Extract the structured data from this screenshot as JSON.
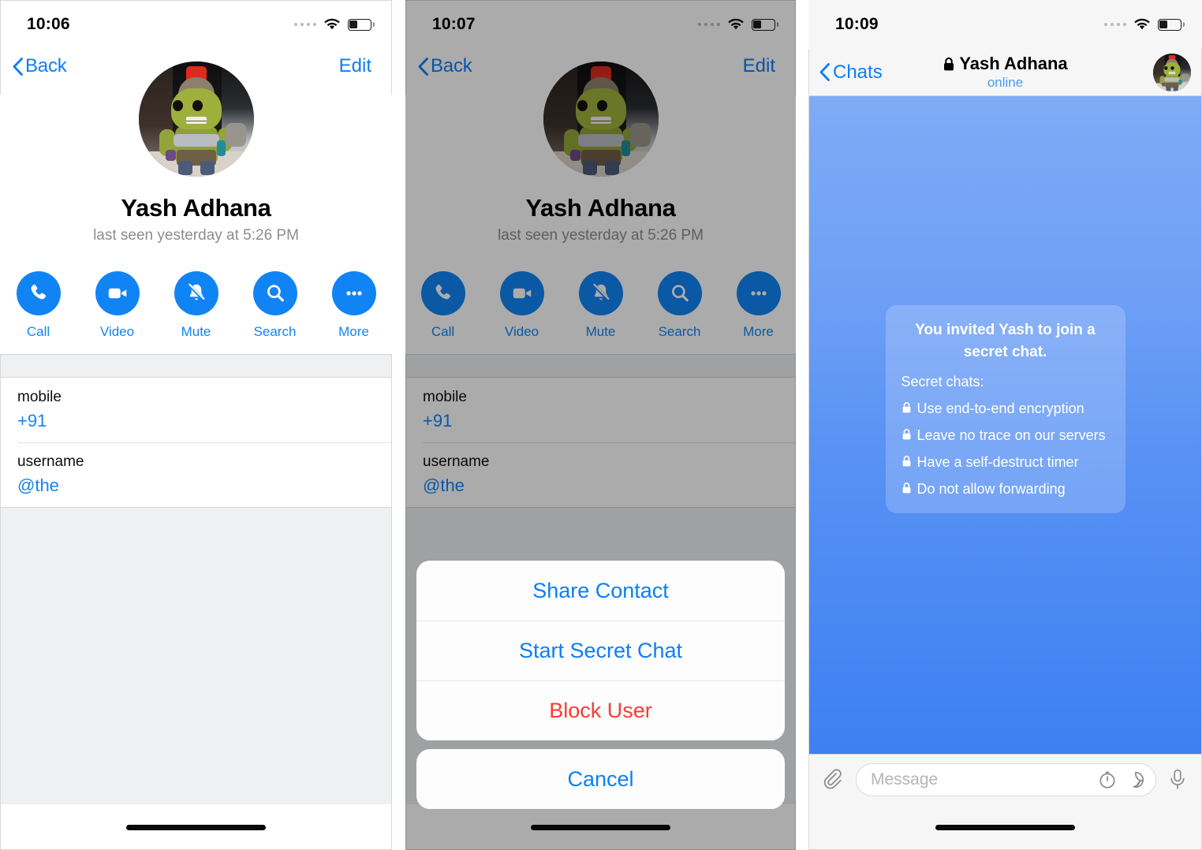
{
  "app": "Telegram iOS",
  "panels": [
    {
      "id": "contact-profile",
      "statusbar": {
        "time": "10:06",
        "signal_icon": "signal-dots-icon",
        "wifi_icon": "wifi-icon",
        "battery_icon": "battery-icon"
      },
      "nav": {
        "back_label": "Back",
        "edit_label": "Edit",
        "back_icon": "chevron-left-icon"
      },
      "profile": {
        "avatar_alt": "hulk-funko-avatar",
        "name": "Yash Adhana",
        "status": "last seen yesterday at 5:26 PM"
      },
      "actions": [
        {
          "label": "Call",
          "icon": "phone-icon"
        },
        {
          "label": "Video",
          "icon": "video-camera-icon"
        },
        {
          "label": "Mute",
          "icon": "bell-slash-icon"
        },
        {
          "label": "Search",
          "icon": "search-icon"
        },
        {
          "label": "More",
          "icon": "ellipsis-icon"
        }
      ],
      "info_rows": [
        {
          "label": "mobile",
          "value": "+91"
        },
        {
          "label": "username",
          "value": "@the"
        }
      ]
    },
    {
      "id": "contact-profile-actionsheet",
      "statusbar": {
        "time": "10:07"
      },
      "nav": {
        "back_label": "Back",
        "edit_label": "Edit"
      },
      "profile": {
        "name": "Yash Adhana",
        "status": "last seen yesterday at 5:26 PM"
      },
      "actions": [
        {
          "label": "Call",
          "icon": "phone-icon"
        },
        {
          "label": "Video",
          "icon": "video-camera-icon"
        },
        {
          "label": "Mute",
          "icon": "bell-slash-icon"
        },
        {
          "label": "Search",
          "icon": "search-icon"
        },
        {
          "label": "More",
          "icon": "ellipsis-icon"
        }
      ],
      "info_rows": [
        {
          "label": "mobile",
          "value": "+91"
        },
        {
          "label": "username",
          "value": "@the"
        }
      ],
      "action_sheet": {
        "items": [
          {
            "label": "Share Contact",
            "style": "default"
          },
          {
            "label": "Start Secret Chat",
            "style": "default"
          },
          {
            "label": "Block User",
            "style": "destructive"
          }
        ],
        "cancel_label": "Cancel"
      }
    },
    {
      "id": "secret-chat",
      "statusbar": {
        "time": "10:09"
      },
      "nav": {
        "back_label": "Chats",
        "title": "Yash Adhana",
        "title_lock_icon": "lock-icon",
        "subtitle": "online",
        "avatar_alt": "hulk-funko-avatar"
      },
      "message": {
        "headline": "You invited Yash to join a secret chat.",
        "intro": "Secret chats:",
        "bullets": [
          "Use end-to-end encryption",
          "Leave no trace on our servers",
          "Have a self-destruct timer",
          "Do not allow forwarding"
        ],
        "bullet_icon": "lock-icon"
      },
      "input_bar": {
        "attach_icon": "paperclip-icon",
        "placeholder": "Message",
        "timer_icon": "self-destruct-timer-icon",
        "sticker_icon": "sticker-icon",
        "mic_icon": "microphone-icon"
      }
    }
  ],
  "colors": {
    "accent_blue": "#0d7ef6",
    "action_blue": "#1184f5",
    "destructive_red": "#f93c2e",
    "status_gray": "#8d8d92",
    "chat_gradient_top": "#7fabf6",
    "chat_gradient_bottom": "#3d80f2"
  }
}
